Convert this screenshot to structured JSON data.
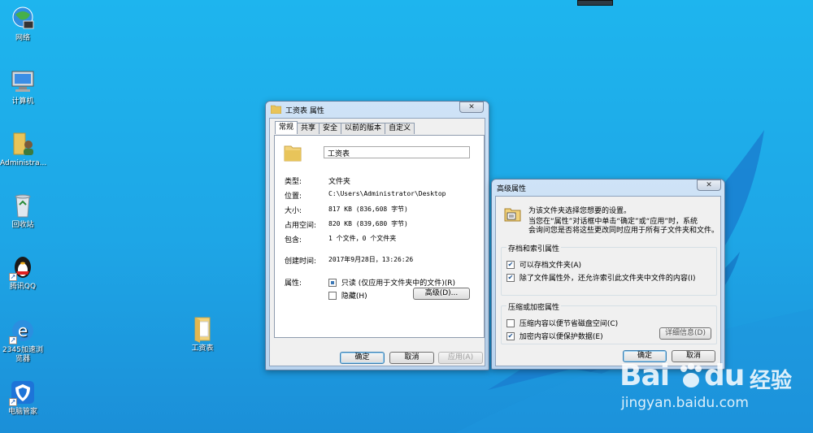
{
  "desktop": {
    "icons": [
      {
        "label": "网络"
      },
      {
        "label": "计算机"
      },
      {
        "label": "Administra..."
      },
      {
        "label": "回收站"
      },
      {
        "label": "腾讯QQ"
      },
      {
        "label": "2345加速浏览器"
      },
      {
        "label": "电脑管家"
      },
      {
        "label": "工资表"
      }
    ]
  },
  "props_window": {
    "title": "工资表 属性",
    "close": "✕",
    "tabs": [
      "常规",
      "共享",
      "安全",
      "以前的版本",
      "自定义"
    ],
    "name_value": "工资表",
    "rows": [
      {
        "label": "类型:",
        "value": "文件夹"
      },
      {
        "label": "位置:",
        "value": "C:\\Users\\Administrator\\Desktop"
      },
      {
        "label": "大小:",
        "value": "817 KB (836,608 字节)"
      },
      {
        "label": "占用空间:",
        "value": "820 KB (839,680 字节)"
      },
      {
        "label": "包含:",
        "value": "1 个文件，0 个文件夹"
      },
      {
        "label": "创建时间:",
        "value": "2017年9月28日，13:26:26"
      }
    ],
    "attr_label": "属性:",
    "readonly_label": "只读 (仅应用于文件夹中的文件)(R)",
    "hidden_label": "隐藏(H)",
    "advanced_button": "高级(D)...",
    "ok": "确定",
    "cancel": "取消",
    "apply": "应用(A)"
  },
  "adv_window": {
    "title": "高级属性",
    "close": "✕",
    "desc1": "为该文件夹选择您想要的设置。",
    "desc2": "当您在“属性”对话框中单击“确定”或“应用”时，系统",
    "desc3": "会询问您是否将这些更改同时应用于所有子文件夹和文件。",
    "group1_title": "存档和索引属性",
    "archive_label": "可以存档文件夹(A)",
    "index_label": "除了文件属性外，还允许索引此文件夹中文件的内容(I)",
    "group2_title": "压缩或加密属性",
    "compress_label": "压缩内容以便节省磁盘空间(C)",
    "encrypt_label": "加密内容以便保护数据(E)",
    "details_button": "详细信息(D)",
    "ok": "确定",
    "cancel": "取消"
  },
  "watermark": {
    "brand": "Bai",
    "brand2": "du",
    "cn": "经验",
    "url": "jingyan.baidu.com"
  },
  "colors": {
    "desktop": "#1ea6e6",
    "accent": "#3c7fb1"
  }
}
